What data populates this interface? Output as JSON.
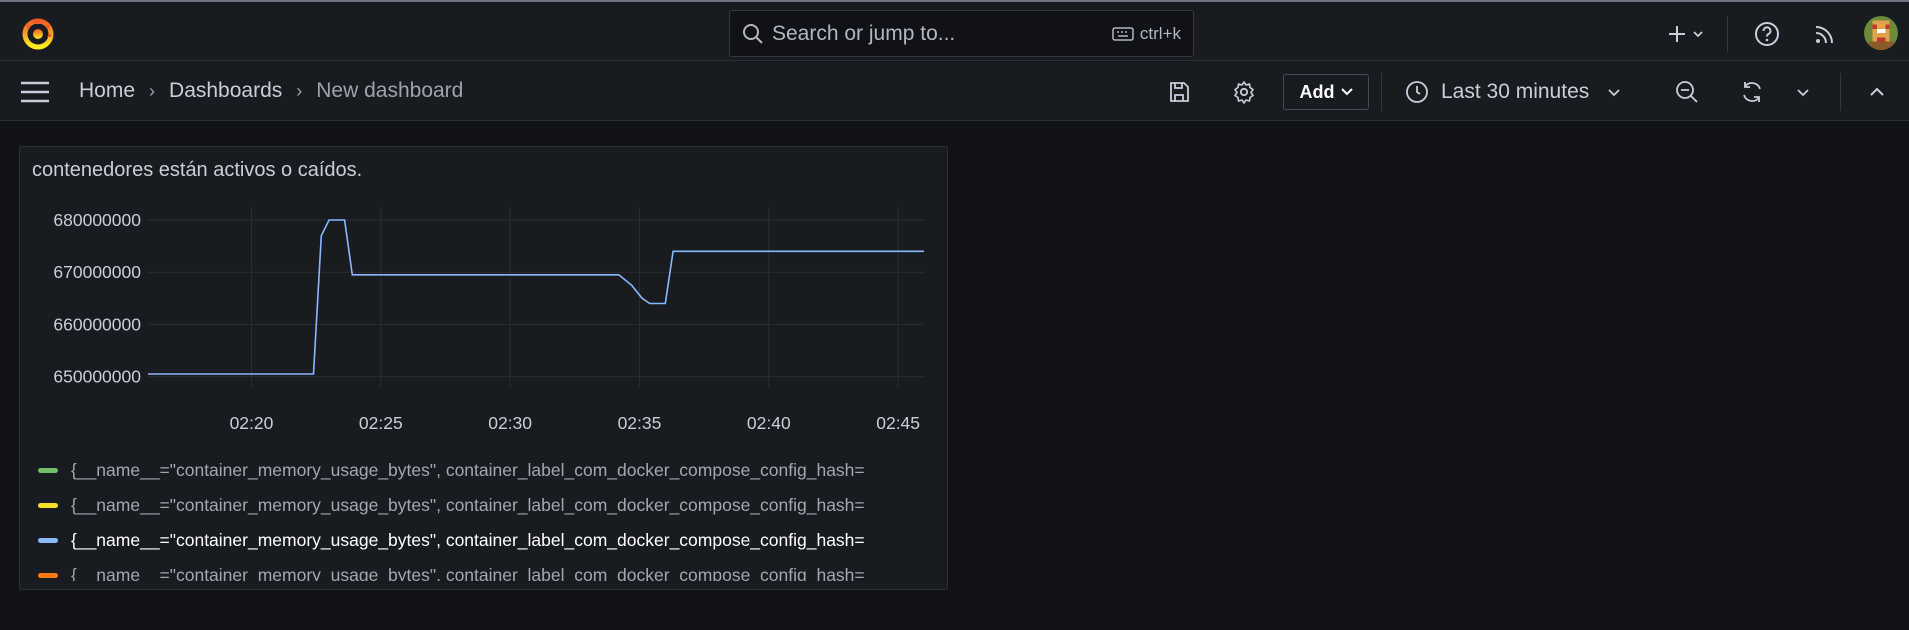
{
  "search": {
    "placeholder": "Search or jump to...",
    "shortcut": "ctrl+k"
  },
  "breadcrumb": {
    "home": "Home",
    "dashboards": "Dashboards",
    "current": "New dashboard"
  },
  "toolbar": {
    "add_label": "Add",
    "time_range": "Last 30 minutes"
  },
  "panel": {
    "title": "contenedores están activos o caídos.",
    "legend": [
      {
        "label": "{__name__=\"container_memory_usage_bytes\", container_label_com_docker_compose_config_hash=",
        "color": "#73bf69"
      },
      {
        "label": "{__name__=\"container_memory_usage_bytes\", container_label_com_docker_compose_config_hash=",
        "color": "#fade2a"
      },
      {
        "label": "{__name__=\"container_memory_usage_bytes\", container_label_com_docker_compose_config_hash=",
        "color": "#8ab8ff"
      },
      {
        "label": "{__name__=\"container_memory_usage_bytes\", container_label_com_docker_compose_config_hash=",
        "color": "#ff780a"
      }
    ]
  },
  "chart_data": {
    "type": "line",
    "title": "contenedores están activos o caídos.",
    "xlabel": "",
    "ylabel": "",
    "x_ticks": [
      "02:20",
      "02:25",
      "02:30",
      "02:35",
      "02:40",
      "02:45"
    ],
    "y_ticks": [
      680000000,
      670000000,
      660000000,
      650000000
    ],
    "ylim": [
      648000000,
      682500000
    ],
    "xlim": [
      "02:16",
      "02:46"
    ],
    "grid": true,
    "legend_position": "bottom",
    "series": [
      {
        "color": "#8ab8ff",
        "points": [
          [
            "02:16",
            650500000
          ],
          [
            "02:22.4",
            650500000
          ],
          [
            "02:22.7",
            677000000
          ],
          [
            "02:23",
            680000000
          ],
          [
            "02:23.6",
            680000000
          ],
          [
            "02:23.9",
            669500000
          ],
          [
            "02:34.2",
            669500000
          ],
          [
            "02:34.7",
            667500000
          ],
          [
            "02:35.1",
            665000000
          ],
          [
            "02:35.4",
            664000000
          ],
          [
            "02:36",
            664000000
          ],
          [
            "02:36.3",
            674000000
          ],
          [
            "02:46",
            674000000
          ]
        ]
      }
    ]
  }
}
